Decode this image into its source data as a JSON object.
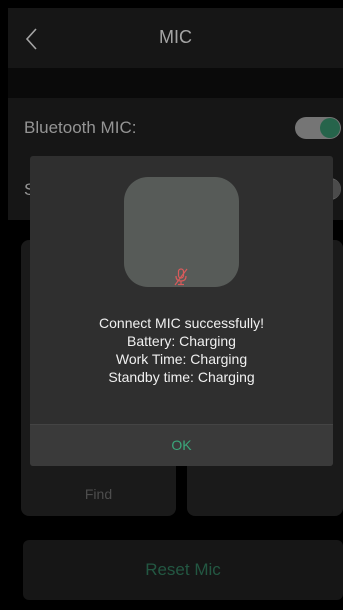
{
  "header": {
    "title": "MIC"
  },
  "settings": {
    "bluetooth_mic_label": "Bluetooth MIC:",
    "bluetooth_mic_on": true,
    "second_row_label_partial": "S",
    "second_row_on": false
  },
  "cards": {
    "find_label": "Find"
  },
  "reset": {
    "label": "Reset Mic"
  },
  "dialog": {
    "line1": "Connect MIC successfully!",
    "line2": "Battery: Charging",
    "line3": "Work Time: Charging",
    "line4": "Standby time: Charging",
    "ok_label": "OK"
  },
  "colors": {
    "accent": "#2f7a5c",
    "ok_text": "#3aa67a",
    "mic_muted_icon": "#d95b5b"
  },
  "icons": {
    "back": "chevron-left-icon",
    "mic": "mic-off-icon"
  }
}
